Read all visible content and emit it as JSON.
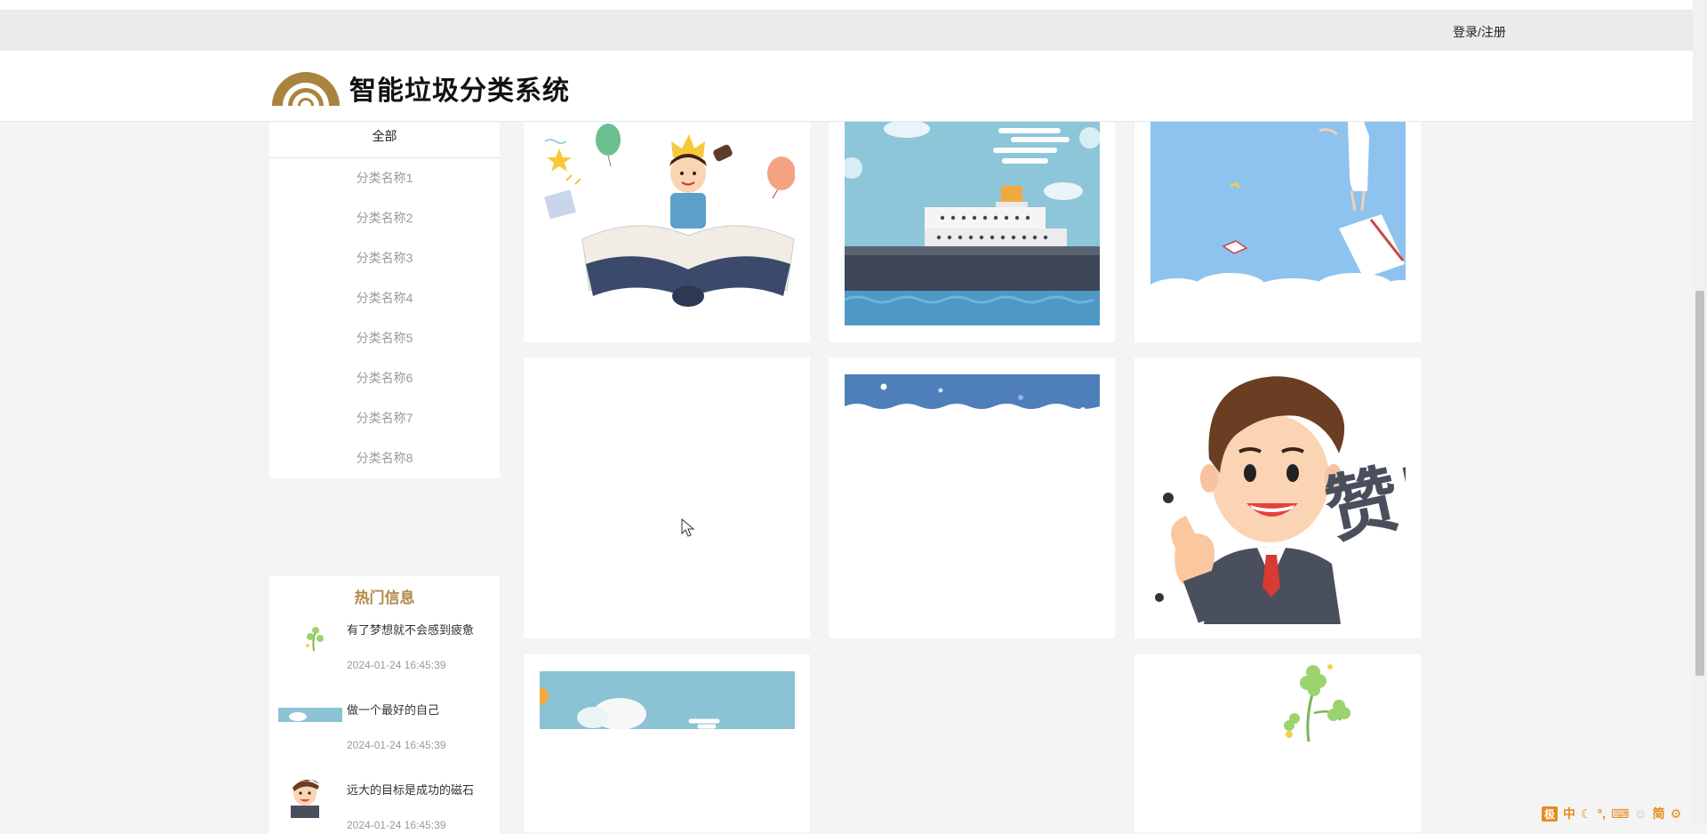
{
  "topbar": {
    "login_label": "登录/注册"
  },
  "header": {
    "site_title": "智能垃圾分类系统"
  },
  "categories": {
    "all_label": "全部",
    "items": [
      "分类名称1",
      "分类名称2",
      "分类名称3",
      "分类名称4",
      "分类名称5",
      "分类名称6",
      "分类名称7",
      "分类名称8"
    ]
  },
  "hot": {
    "title": "热门信息",
    "items": [
      {
        "text": "有了梦想就不会感到疲惫",
        "time": "2024-01-24 16:45:39"
      },
      {
        "text": "做一个最好的自己",
        "time": "2024-01-24 16:45:39"
      },
      {
        "text": "远大的目标是成功的磁石",
        "time": "2024-01-24 16:45:39"
      }
    ]
  },
  "ime": {
    "badge": "极",
    "mode": "中",
    "simp": "简"
  },
  "colors": {
    "accent": "#b08a47",
    "topbar": "#ebebeb",
    "page_bg": "#f4f4f4"
  }
}
